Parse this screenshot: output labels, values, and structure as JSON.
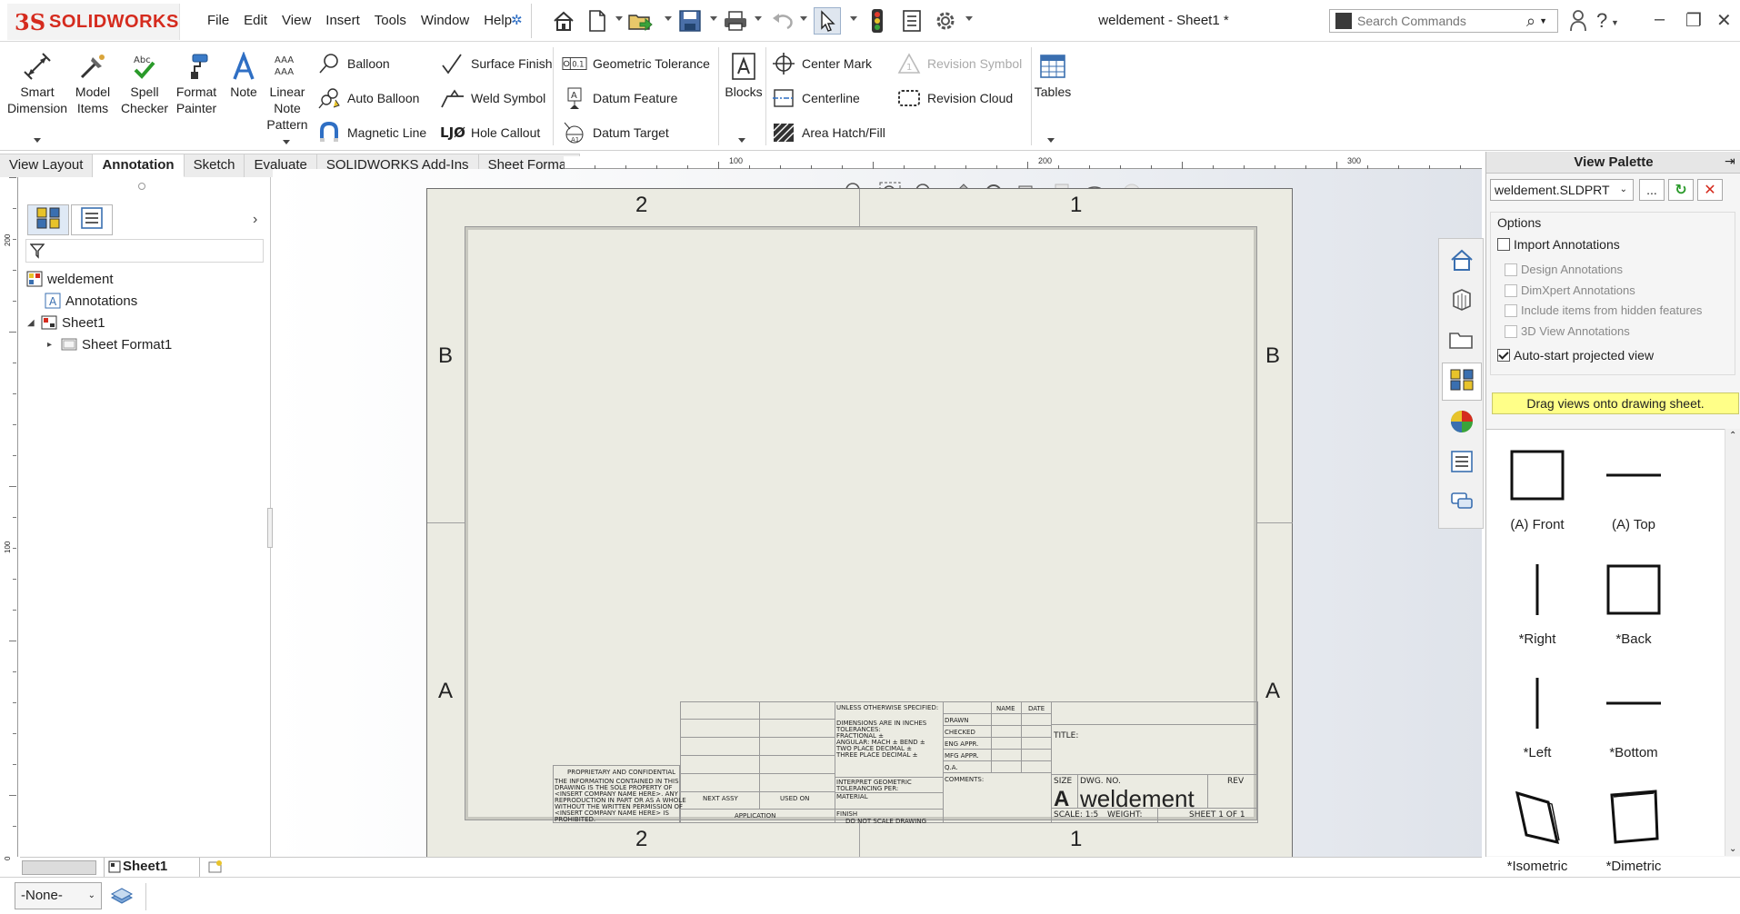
{
  "app": {
    "logo_ds": "3S",
    "logo_name": "SOLIDWORKS",
    "doc_title": "weldement - Sheet1 *"
  },
  "menu": [
    "File",
    "Edit",
    "View",
    "Insert",
    "Tools",
    "Window",
    "Help"
  ],
  "search": {
    "placeholder": "Search Commands"
  },
  "ribbon": {
    "smart_dimension": [
      "Smart",
      "Dimension"
    ],
    "model_items": [
      "Model",
      "Items"
    ],
    "spell_checker": [
      "Spell",
      "Checker"
    ],
    "format_painter": [
      "Format",
      "Painter"
    ],
    "note": "Note",
    "linear_note_pattern": [
      "Linear",
      "Note",
      "Pattern"
    ],
    "balloon": "Balloon",
    "auto_balloon": "Auto Balloon",
    "magnetic_line": "Magnetic Line",
    "surface_finish": "Surface Finish",
    "weld_symbol": "Weld Symbol",
    "hole_callout": "Hole Callout",
    "geometric_tolerance": "Geometric Tolerance",
    "datum_feature": "Datum Feature",
    "datum_target": "Datum Target",
    "blocks": "Blocks",
    "center_mark": "Center Mark",
    "centerline": "Centerline",
    "area_hatch": "Area Hatch/Fill",
    "revision_symbol": "Revision Symbol",
    "revision_cloud": "Revision Cloud",
    "tables": "Tables",
    "spell_abc": "Abc",
    "linear_aaa": "AAA",
    "hole_glyph": "LJØ",
    "geo_tol_glyph": "0.1"
  },
  "tabs": [
    "View Layout",
    "Annotation",
    "Sketch",
    "Evaluate",
    "SOLIDWORKS Add-Ins",
    "Sheet Format"
  ],
  "active_tab": "Annotation",
  "ruler_top": [
    "100",
    "200",
    "300"
  ],
  "ruler_left": [
    "200",
    "100",
    "0"
  ],
  "tree": {
    "root": "weldement",
    "annotations": "Annotations",
    "sheet": "Sheet1",
    "sheet_format": "Sheet Format1"
  },
  "sheet": {
    "zone_top_left": "2",
    "zone_top_right": "1",
    "zone_bottom_left": "2",
    "zone_bottom_right": "1",
    "row_b_left": "B",
    "row_b_right": "B",
    "row_a_left": "A",
    "row_a_right": "A",
    "title_block": {
      "unless": "UNLESS OTHERWISE SPECIFIED:",
      "dims_note": [
        "DIMENSIONS ARE IN INCHES",
        "TOLERANCES:",
        "FRACTIONAL ±",
        "ANGULAR: MACH ±   BEND ±",
        "TWO PLACE DECIMAL   ±",
        "THREE PLACE DECIMAL  ±"
      ],
      "interpret": [
        "INTERPRET GEOMETRIC",
        "TOLERANCING PER:"
      ],
      "material": "MATERIAL",
      "finish": "FINISH",
      "do_not_scale": "DO NOT SCALE DRAWING",
      "name": "NAME",
      "date": "DATE",
      "drawn": "DRAWN",
      "checked": "CHECKED",
      "eng_appr": "ENG APPR.",
      "mfg_appr": "MFG APPR.",
      "qa": "Q.A.",
      "comments": "COMMENTS:",
      "title": "TITLE:",
      "size": "SIZE",
      "dwg_no": "DWG.  NO.",
      "rev": "REV",
      "size_letter": "A",
      "dwg_name": "weldement",
      "scale": "SCALE: 1:5",
      "weight": "WEIGHT:",
      "sheet_of": "SHEET 1 OF 1",
      "next_assy": "NEXT ASSY",
      "used_on": "USED ON",
      "application": "APPLICATION",
      "proprietary_title": "PROPRIETARY AND CONFIDENTIAL",
      "proprietary_body": [
        "THE INFORMATION CONTAINED IN THIS",
        "DRAWING IS THE SOLE PROPERTY OF",
        "<INSERT COMPANY NAME HERE>. ANY",
        "REPRODUCTION IN PART OR AS A WHOLE",
        "WITHOUT THE WRITTEN PERMISSION OF",
        "<INSERT COMPANY NAME HERE> IS",
        "PROHIBITED."
      ]
    }
  },
  "view_palette": {
    "title": "View Palette",
    "document": "weldement.SLDPRT",
    "browse_label": "...",
    "options_label": "Options",
    "import_annotations": "Import Annotations",
    "design_annotations": "Design Annotations",
    "dimxpert_annotations": "DimXpert Annotations",
    "hidden_features": "Include items from hidden features",
    "view_3d_annotations": "3D View Annotations",
    "auto_start": "Auto-start projected view",
    "hint": "Drag views onto drawing sheet.",
    "views": [
      "(A) Front",
      "(A) Top",
      "*Right",
      "*Back",
      "*Left",
      "*Bottom",
      "*Isometric",
      "*Dimetric"
    ]
  },
  "bottom": {
    "sheet_tab": "Sheet1",
    "layer_combo": "-None-"
  },
  "colors": {
    "accent": "#d52b1e",
    "sheet_bg": "#ebebe2",
    "hint_bg": "#ffff88",
    "tab_active": "#ffffff"
  }
}
